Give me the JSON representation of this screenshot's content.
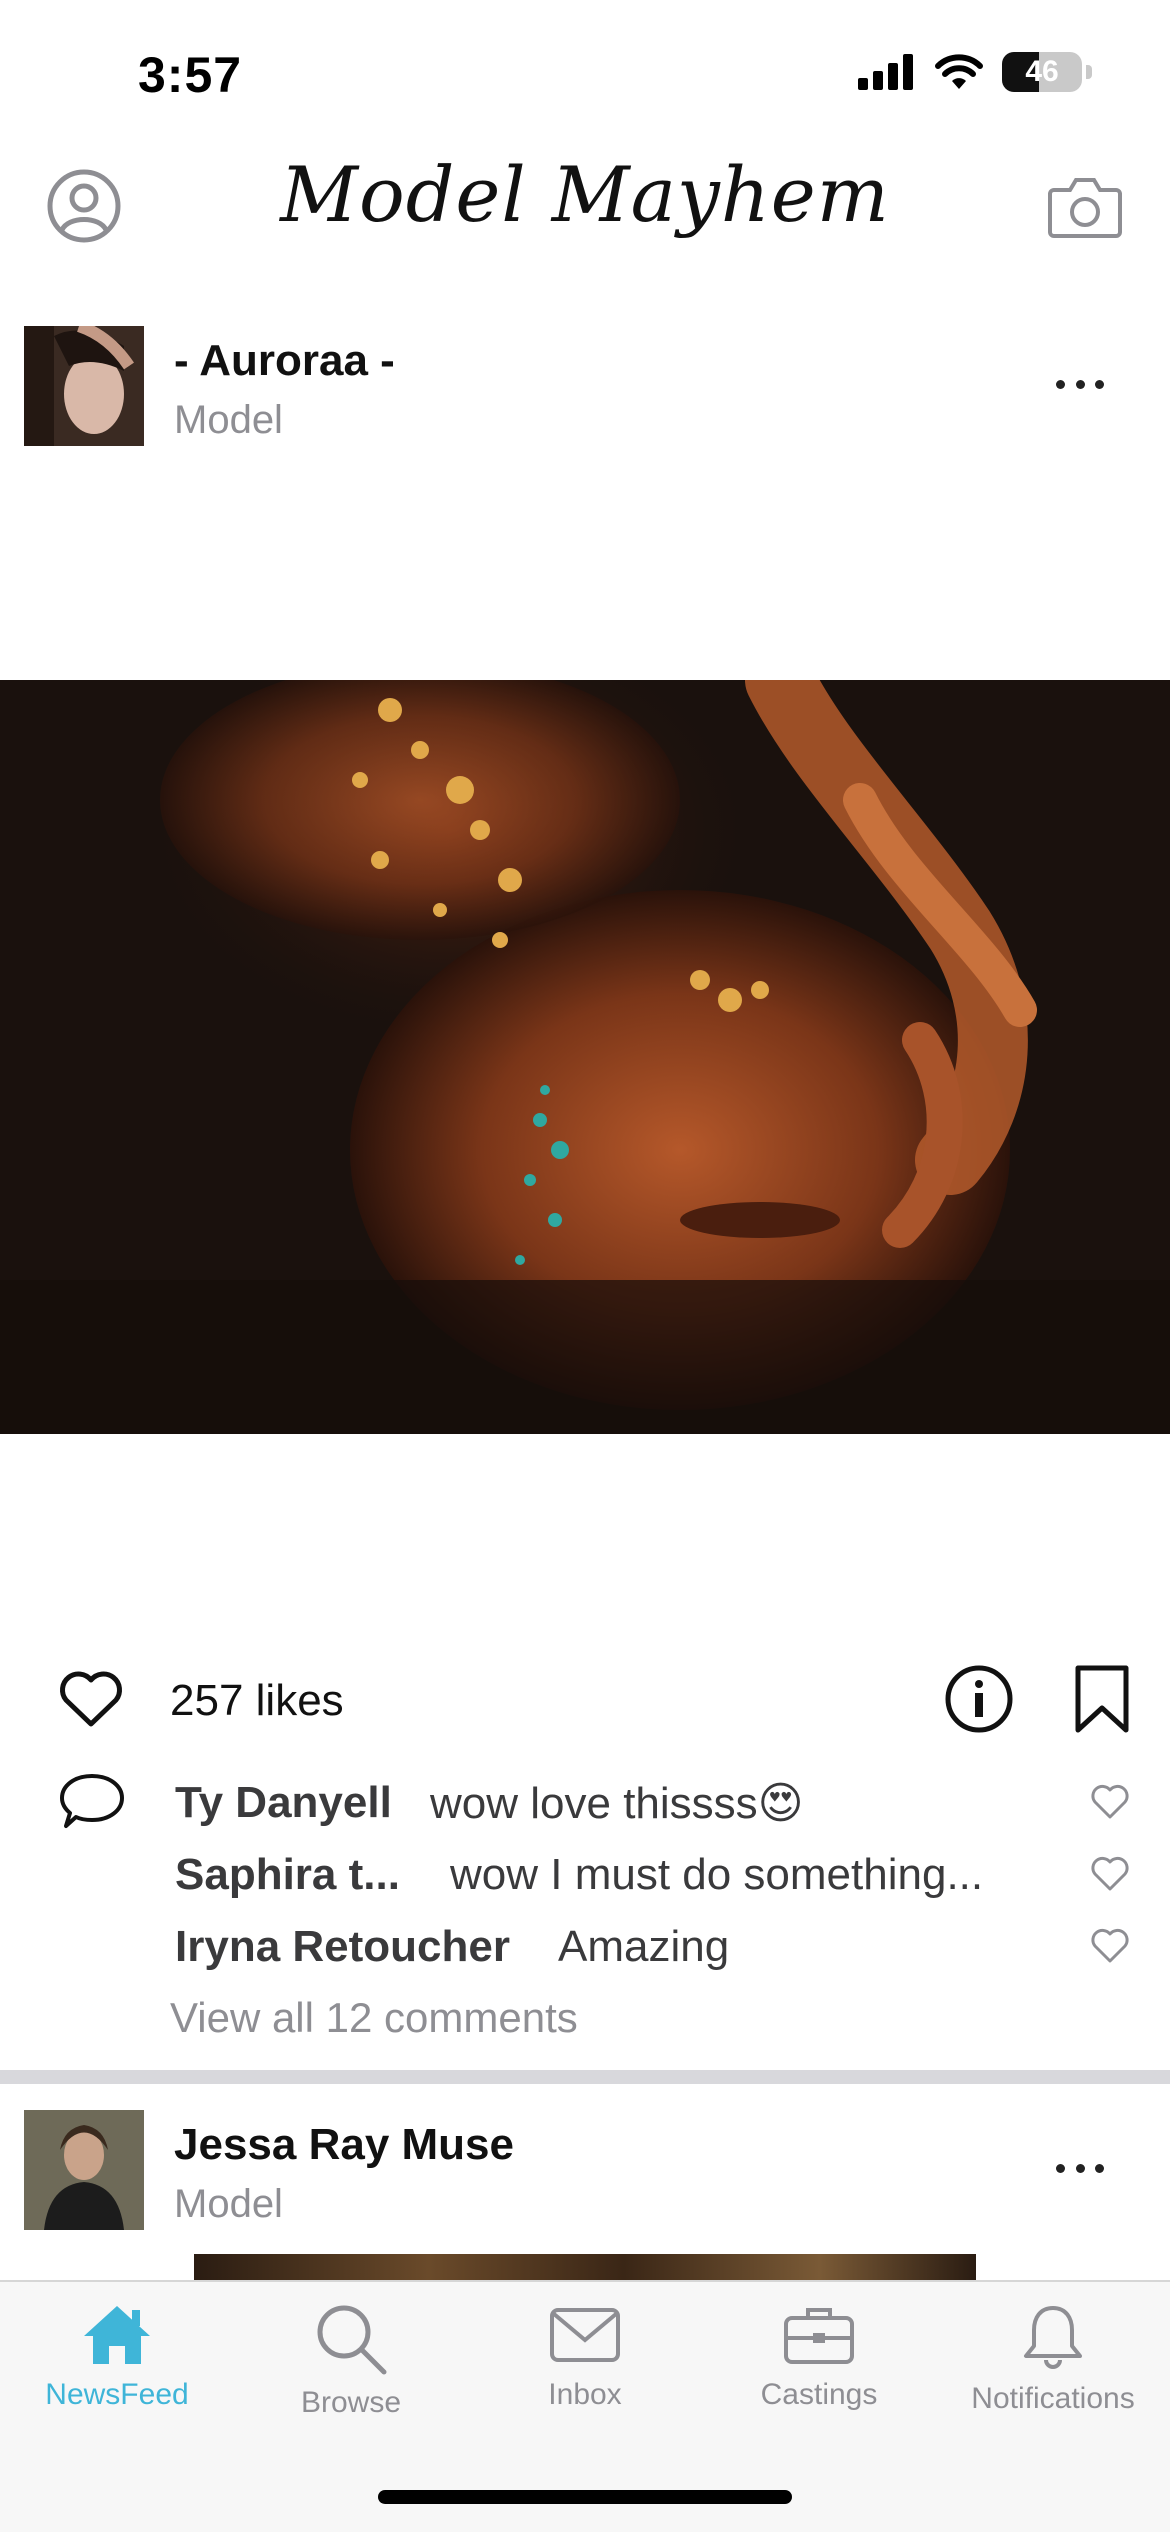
{
  "status_bar": {
    "time": "3:57",
    "battery_level": "46",
    "battery_fraction": 0.46
  },
  "header": {
    "title": "Model Mayhem"
  },
  "posts": [
    {
      "author": "- Auroraa -",
      "role": "Model",
      "likes": "257 likes",
      "comments": [
        {
          "author": "Ty Danyell",
          "text": "wow love thissss😍"
        },
        {
          "author": "Saphira t...",
          "text": "wow I must do something..."
        },
        {
          "author": "Iryna Retoucher",
          "text": "Amazing"
        }
      ],
      "view_all": "View all 12 comments"
    },
    {
      "author": "Jessa Ray Muse",
      "role": "Model"
    }
  ],
  "tabs": [
    {
      "label": "NewsFeed",
      "icon": "home-icon",
      "active": true
    },
    {
      "label": "Browse",
      "icon": "search-icon",
      "active": false
    },
    {
      "label": "Inbox",
      "icon": "mail-icon",
      "active": false
    },
    {
      "label": "Castings",
      "icon": "briefcase-icon",
      "active": false
    },
    {
      "label": "Notifications",
      "icon": "bell-icon",
      "active": false
    }
  ],
  "colors": {
    "accent": "#3fb5d8",
    "muted": "#8e8e93",
    "divider": "#d8d8dc"
  }
}
